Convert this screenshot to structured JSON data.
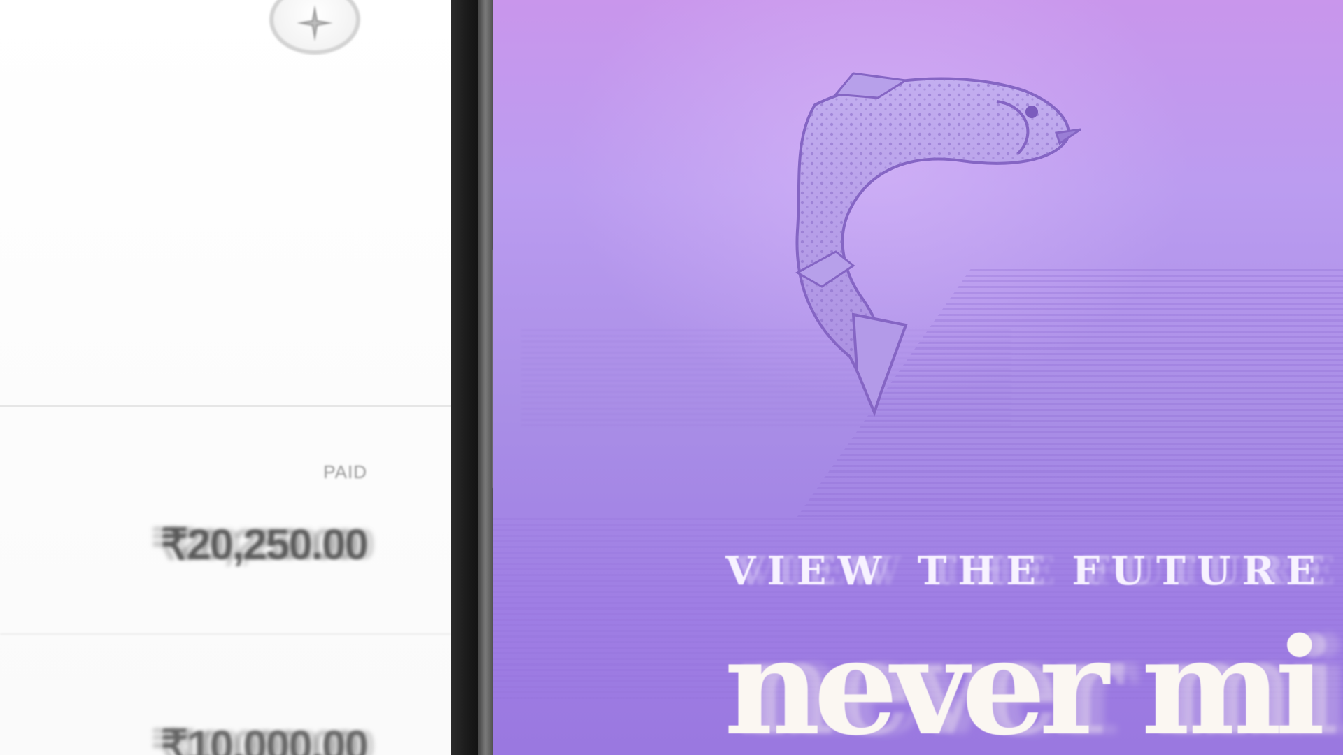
{
  "transactions_panel": {
    "entries": [
      {
        "status": "PAID",
        "amount": "₹20,250.00"
      },
      {
        "status": "",
        "amount": "₹10,000.00"
      }
    ],
    "logo_icon": "sparkle-badge-icon"
  },
  "phone_screen": {
    "illustration": "leaping-trout-engraving",
    "eyebrow": "VIEW THE FUTURE",
    "headline": "never mi",
    "colors": {
      "background_top": "#c996ec",
      "background_bottom": "#9a78e0",
      "text": "#fbf7f2"
    }
  }
}
